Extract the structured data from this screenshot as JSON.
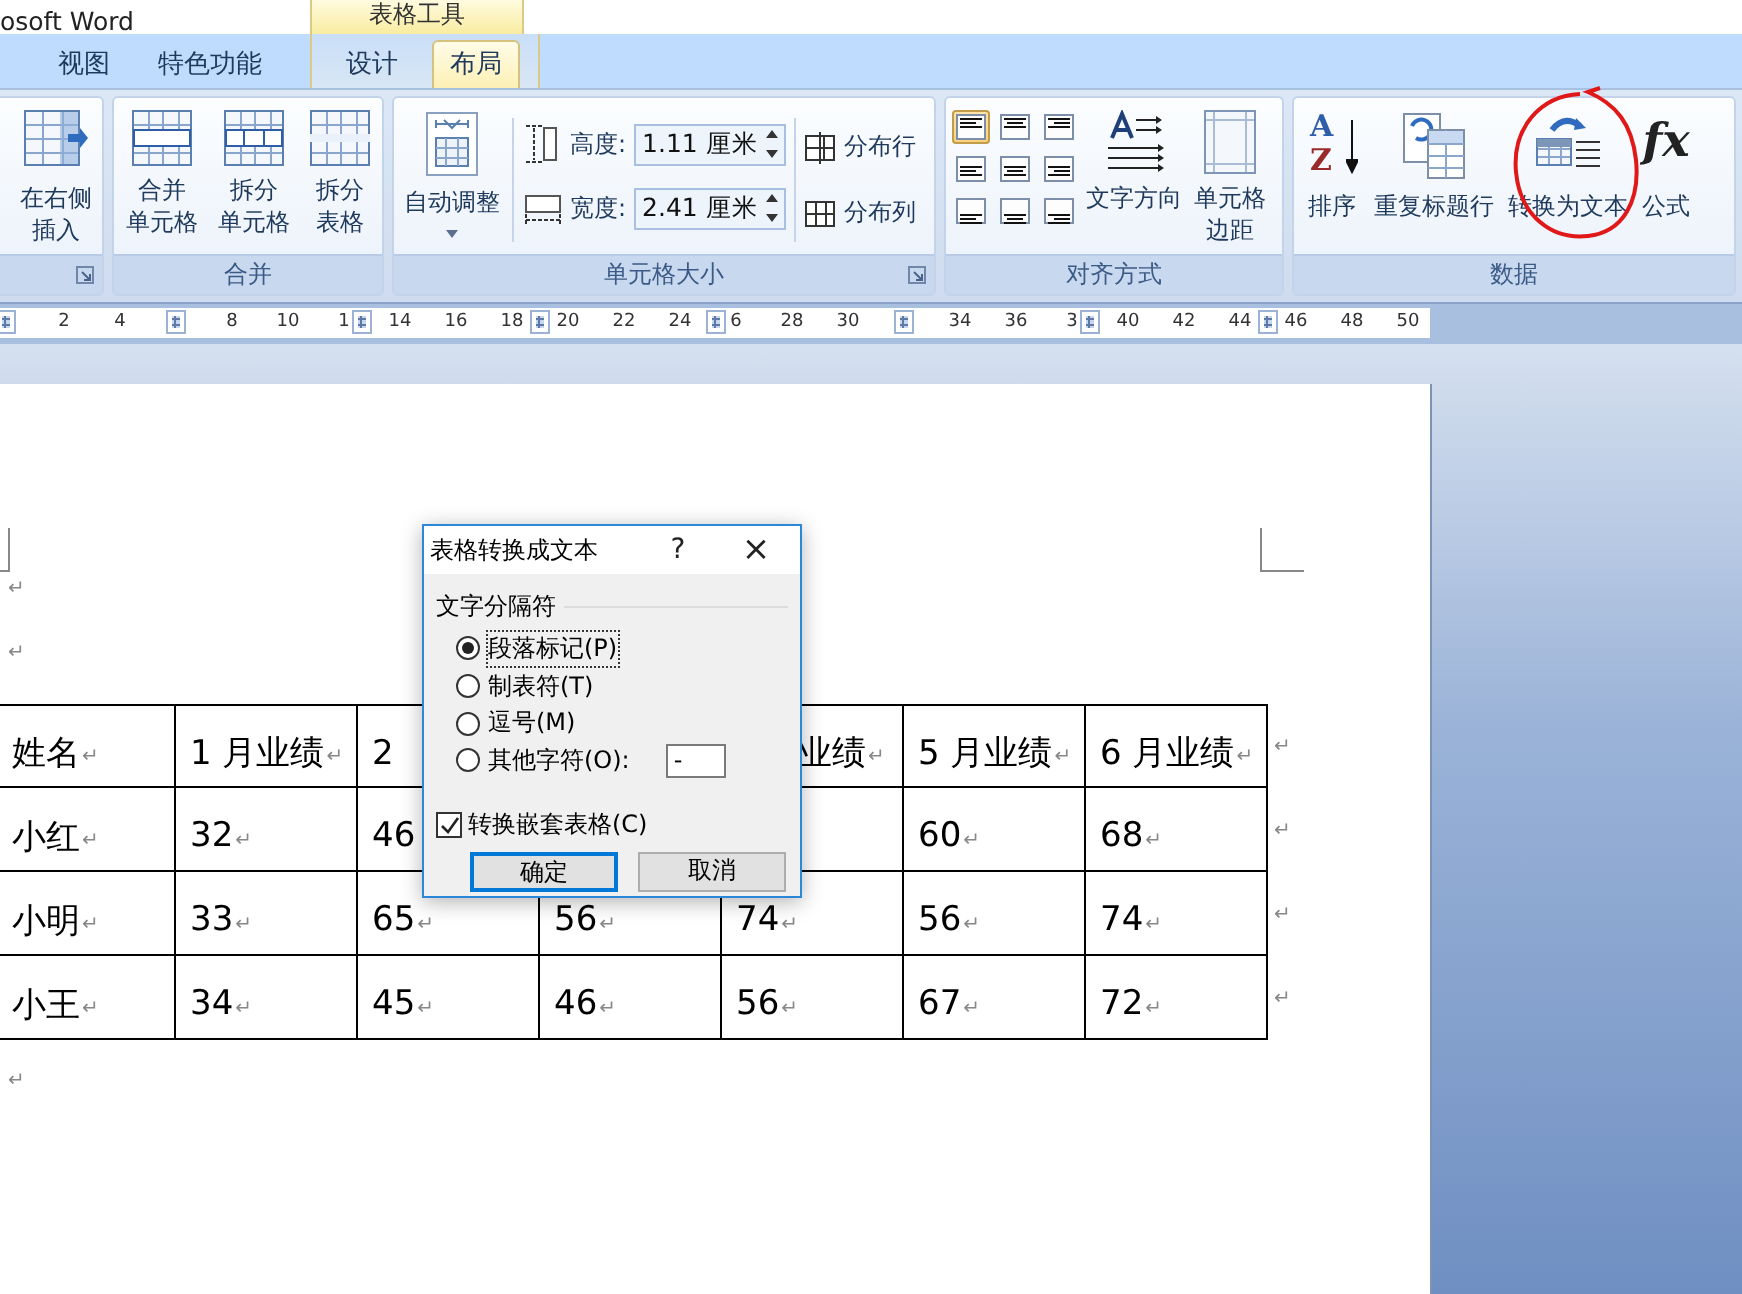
{
  "window": {
    "title": "osoft Word",
    "context_header": "表格工具"
  },
  "tabs": [
    {
      "label": "视图",
      "selected": false,
      "contextual": false
    },
    {
      "label": "特色功能",
      "selected": false,
      "contextual": false
    },
    {
      "label": "设计",
      "selected": false,
      "contextual": true
    },
    {
      "label": "布局",
      "selected": true,
      "contextual": true
    }
  ],
  "ribbon": {
    "insert_group": {
      "button": [
        "在右侧",
        "插入"
      ]
    },
    "merge_group": {
      "label": "合并",
      "buttons": [
        [
          "合并",
          "单元格"
        ],
        [
          "拆分",
          "单元格"
        ],
        [
          "拆分",
          "表格"
        ]
      ]
    },
    "cell_size_group": {
      "label": "单元格大小",
      "autofit": "自动调整",
      "height": {
        "label": "高度:",
        "value": "1.11 厘米"
      },
      "width": {
        "label": "宽度:",
        "value": "2.41 厘米"
      },
      "distribute": [
        "分布行",
        "分布列"
      ]
    },
    "alignment_group": {
      "label": "对齐方式",
      "alignments": [
        {
          "selected": true
        },
        {
          "selected": false
        },
        {
          "selected": false
        },
        {
          "selected": false
        },
        {
          "selected": false
        },
        {
          "selected": false
        },
        {
          "selected": false
        },
        {
          "selected": false
        },
        {
          "selected": false
        }
      ],
      "text_direction": "文字方向",
      "cell_margins": [
        "单元格",
        "边距"
      ]
    },
    "data_group": {
      "label": "数据",
      "buttons": [
        {
          "kind": "sort",
          "label": "排序",
          "glyphs": [
            "A",
            "Z"
          ]
        },
        {
          "kind": "repeat",
          "label": "重复标题行"
        },
        {
          "kind": "convert",
          "label": "转换为文本"
        },
        {
          "kind": "formula",
          "label": "公式",
          "glyph": "fx"
        }
      ]
    }
  },
  "ruler": [
    "2",
    "4",
    "8",
    "10",
    "1",
    "14",
    "16",
    "18",
    "20",
    "22",
    "24",
    "6",
    "28",
    "30",
    "34",
    "36",
    "3",
    "40",
    "42",
    "44",
    "46",
    "48",
    "50"
  ],
  "document": {
    "marks_before": [
      "↵",
      "↵"
    ],
    "table": {
      "rows": [
        {
          "cells": [
            {
              "text": "姓名",
              "mark": "↵"
            },
            {
              "text": "1 月业绩",
              "mark": "↵"
            },
            {
              "text": "2"
            },
            null,
            {
              "text": "业绩",
              "mark": "↵"
            },
            {
              "text": "5 月业绩",
              "mark": "↵"
            },
            {
              "text": "6 月业绩",
              "mark": "↵"
            }
          ],
          "end_mark": "↵"
        },
        {
          "cells": [
            {
              "text": "小红",
              "mark": "↵"
            },
            {
              "text": "32",
              "mark": "↵"
            },
            {
              "text": "46"
            },
            null,
            null,
            {
              "text": "60",
              "mark": "↵"
            },
            {
              "text": "68",
              "mark": "↵"
            }
          ],
          "end_mark": "↵"
        },
        {
          "cells": [
            {
              "text": "小明",
              "mark": "↵"
            },
            {
              "text": "33",
              "mark": "↵"
            },
            {
              "text": "65",
              "mark": "↵"
            },
            {
              "text": "56",
              "mark": "↵"
            },
            {
              "text": "74",
              "mark": "↵"
            },
            {
              "text": "56",
              "mark": "↵"
            },
            {
              "text": "74",
              "mark": "↵"
            }
          ],
          "end_mark": "↵"
        },
        {
          "cells": [
            {
              "text": "小王",
              "mark": "↵"
            },
            {
              "text": "34",
              "mark": "↵"
            },
            {
              "text": "45",
              "mark": "↵"
            },
            {
              "text": "46",
              "mark": "↵"
            },
            {
              "text": "56",
              "mark": "↵"
            },
            {
              "text": "67",
              "mark": "↵"
            },
            {
              "text": "72",
              "mark": "↵"
            }
          ],
          "end_mark": "↵"
        }
      ]
    },
    "marks_after": [
      "↵"
    ]
  },
  "dialog": {
    "title": "表格转换成文本",
    "help": "?",
    "close": "×",
    "group_label": "文字分隔符",
    "separators": [
      {
        "label": "段落标记(P)",
        "selected": true
      },
      {
        "label": "制表符(T)",
        "selected": false
      },
      {
        "label": "逗号(M)",
        "selected": false
      },
      {
        "label": "其他字符(O):",
        "selected": false
      }
    ],
    "other_char": "-",
    "nested": {
      "label": "转换嵌套表格(C)",
      "checked": true
    },
    "buttons": [
      {
        "label": "确定",
        "default": true
      },
      {
        "label": "取消",
        "default": false
      }
    ]
  },
  "annotation": {
    "kind": "circle"
  }
}
